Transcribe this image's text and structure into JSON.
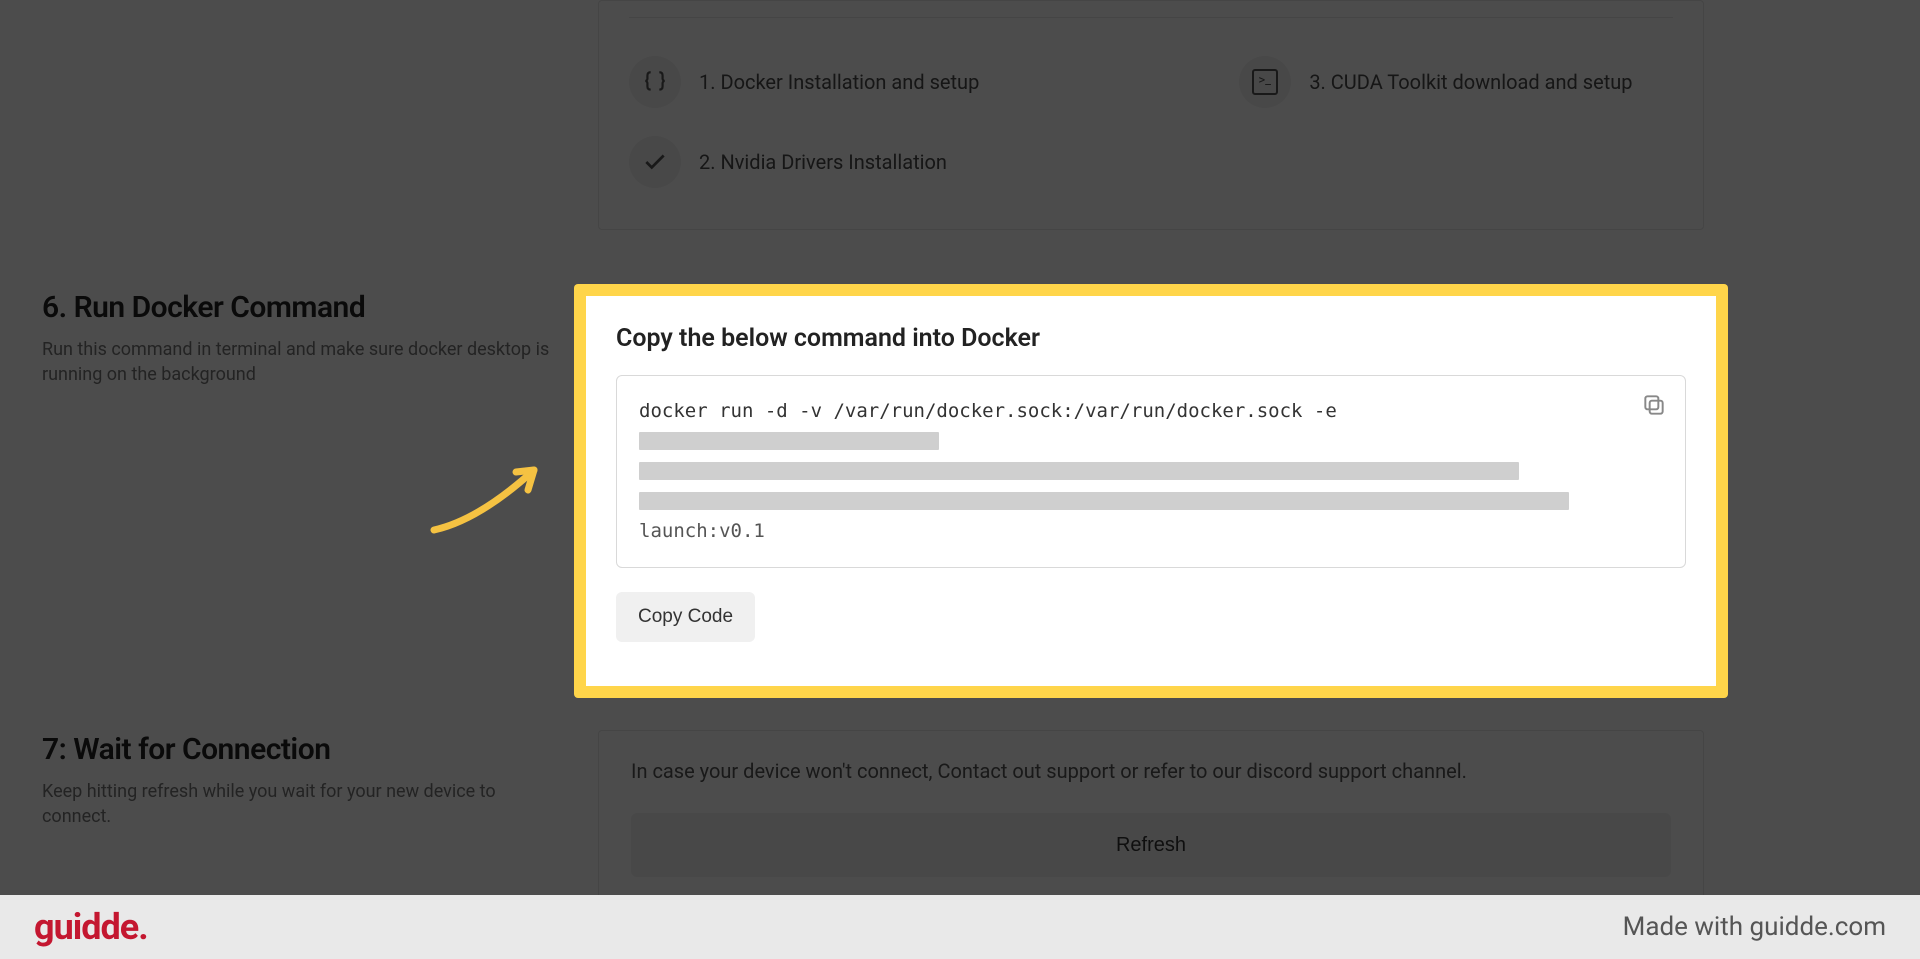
{
  "prereq": {
    "item1": "1. Docker Installation and setup",
    "item2": "2. Nvidia Drivers Installation",
    "item3": "3. CUDA Toolkit download and setup"
  },
  "step6": {
    "title": "6. Run Docker Command",
    "desc": "Run this command in terminal and make sure docker desktop is running on the background"
  },
  "step7": {
    "title": "7: Wait for Connection",
    "desc": "Keep hitting refresh while you wait for your new device to connect."
  },
  "conn": {
    "text": "In case your device won't connect, Contact out support or refer to our discord support channel.",
    "refresh": "Refresh"
  },
  "docker": {
    "heading": "Copy the below command into Docker",
    "cmd_prefix": "docker run -d -v /var/run/docker.sock:/var/run/docker.sock -e",
    "cmd_tail": "launch:v0.1",
    "copy_btn": "Copy Code"
  },
  "footer": {
    "logo": "guidde.",
    "made": "Made with guidde.com"
  }
}
